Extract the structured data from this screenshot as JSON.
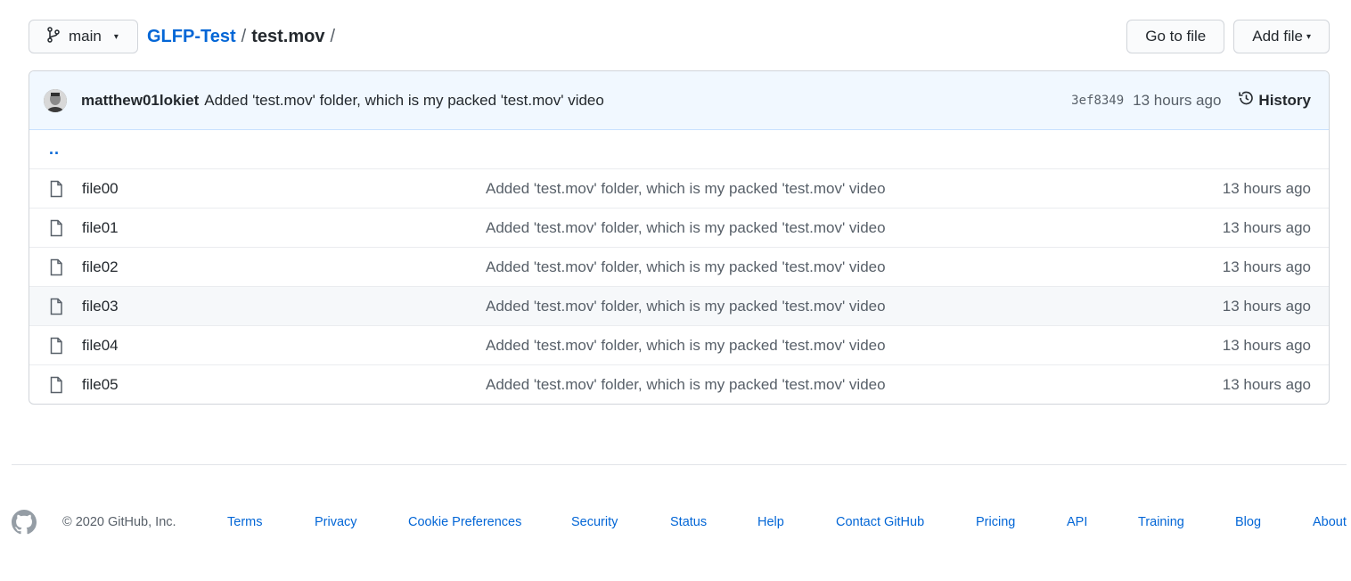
{
  "topbar": {
    "branch_label": "main",
    "breadcrumb": {
      "repo": "GLFP-Test",
      "separator1": "/",
      "folder": "test.mov",
      "separator2": "/"
    },
    "go_to_file_label": "Go to file",
    "add_file_label": "Add file"
  },
  "commit": {
    "author": "matthew01lokiet",
    "message": "Added 'test.mov' folder, which is my packed 'test.mov' video",
    "sha": "3ef8349",
    "time": "13 hours ago",
    "history_label": "History"
  },
  "files": {
    "parent_label": "..",
    "rows": [
      {
        "name": "file00",
        "message": "Added 'test.mov' folder, which is my packed 'test.mov' video",
        "time": "13 hours ago"
      },
      {
        "name": "file01",
        "message": "Added 'test.mov' folder, which is my packed 'test.mov' video",
        "time": "13 hours ago"
      },
      {
        "name": "file02",
        "message": "Added 'test.mov' folder, which is my packed 'test.mov' video",
        "time": "13 hours ago"
      },
      {
        "name": "file03",
        "message": "Added 'test.mov' folder, which is my packed 'test.mov' video",
        "time": "13 hours ago"
      },
      {
        "name": "file04",
        "message": "Added 'test.mov' folder, which is my packed 'test.mov' video",
        "time": "13 hours ago"
      },
      {
        "name": "file05",
        "message": "Added 'test.mov' folder, which is my packed 'test.mov' video",
        "time": "13 hours ago"
      }
    ]
  },
  "footer": {
    "copyright": "© 2020 GitHub, Inc.",
    "links": [
      "Terms",
      "Privacy",
      "Cookie Preferences",
      "Security",
      "Status",
      "Help",
      "Contact GitHub",
      "Pricing",
      "API",
      "Training",
      "Blog",
      "About"
    ]
  },
  "colors": {
    "link": "#0366d6",
    "commit_header_bg": "#f1f8ff",
    "border": "#d1d5da",
    "muted_text": "#586069"
  }
}
